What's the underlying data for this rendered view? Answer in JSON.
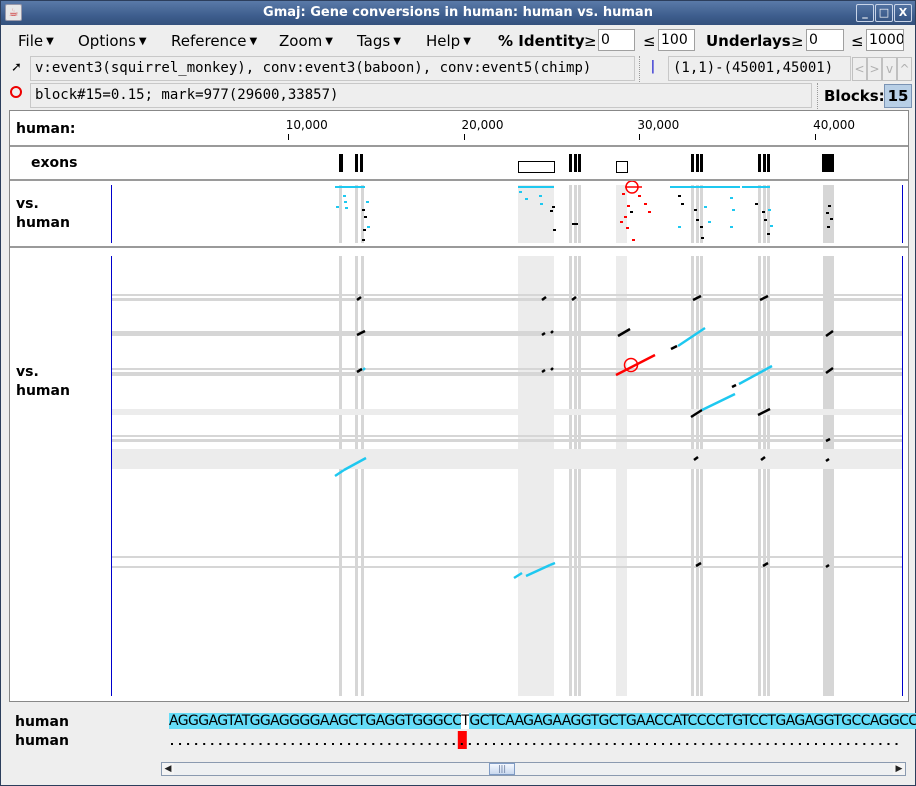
{
  "window": {
    "title": "Gmaj: Gene conversions in human: human vs. human",
    "controls": {
      "minimize": "_",
      "maximize": "□",
      "close": "X"
    }
  },
  "menubar": {
    "menus": [
      "File",
      "Options",
      "Reference",
      "Zoom",
      "Tags",
      "Help"
    ],
    "identity_label": "% Identity",
    "identity_min": "0",
    "identity_max": "100",
    "underlays_label": "Underlays",
    "underlays_min": "0",
    "underlays_max": "1000",
    "ge_symbol": "≥",
    "le_symbol": "≤"
  },
  "info": {
    "pointer_icon": "arrow-pointer-icon",
    "pointer_text": "v:event3(squirrel_monkey), conv:event3(baboon), conv:event5(chimp)",
    "dotplot_icon": "parallel-bars-icon",
    "coords": "(1,1)-(45001,45001)",
    "nav_buttons": [
      "<",
      ">",
      "v",
      "^"
    ],
    "mark_icon": "circle-mark-icon",
    "mark_text": "block#15=0.15; mark=977(29600,33857)",
    "blocks_label": "Blocks:",
    "blocks_value": "15"
  },
  "panels": {
    "ruler_label": "human:",
    "ruler_ticks": [
      {
        "label": "10,000",
        "pos": 10000
      },
      {
        "label": "20,000",
        "pos": 20000
      },
      {
        "label": "30,000",
        "pos": 30000
      },
      {
        "label": "40,000",
        "pos": 40000
      }
    ],
    "exons_label": "exons",
    "pip_label_1": "vs.",
    "pip_label_2": "human",
    "dotplot_label_1": "vs.",
    "dotplot_label_2": "human"
  },
  "sequence": {
    "row1_label": "human",
    "row2_label": "human",
    "seq_left": "AGGGAGTATGGAGGGGAAGCTGAGGTGGGCC",
    "seq_cursor": "T",
    "seq_right": "GCTCAAGAGAAGGTGCTGAACCATCCCCTGTCCTGAGAGGTGCCAGGCC",
    "highlight_color": "#66ddf8",
    "cursor_color": "#ff0000"
  },
  "colors": {
    "conversion": "#1ec8f0",
    "mark": "#ff0000",
    "match": "#000000",
    "border_line": "#0000cc"
  }
}
